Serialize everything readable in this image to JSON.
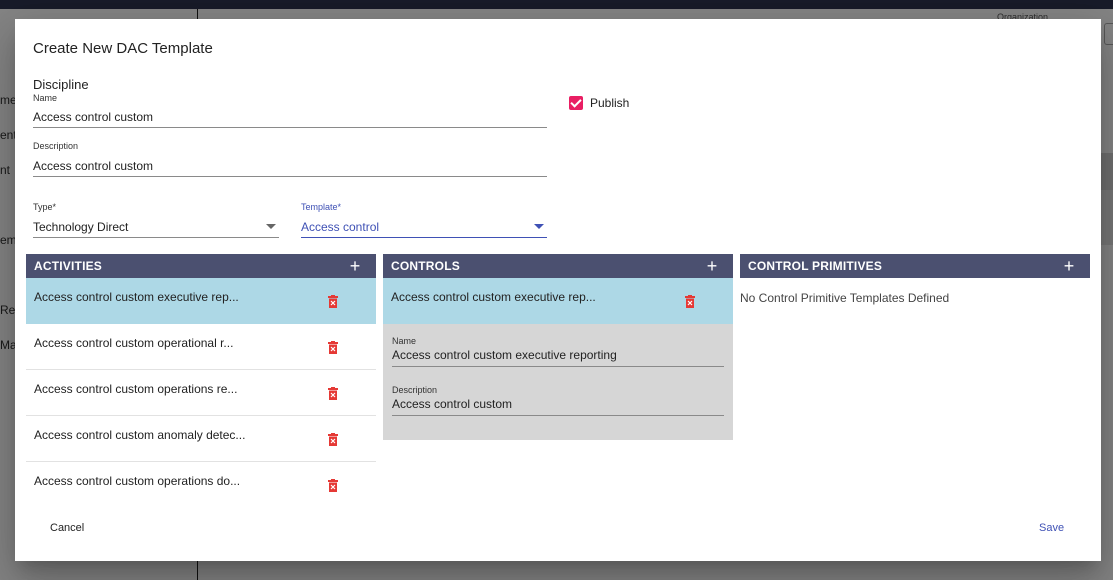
{
  "background": {
    "sidebar_fragments": [
      "me",
      "ent",
      "nt",
      "eme",
      "Re",
      "Ma"
    ],
    "org_label": "Organization"
  },
  "dialog": {
    "title": "Create New DAC Template",
    "section_label": "Discipline",
    "name": {
      "label": "Name",
      "value": "Access control custom"
    },
    "description": {
      "label": "Description",
      "value": "Access control custom"
    },
    "publish": {
      "label": "Publish",
      "checked": true,
      "color": "#e91e63"
    },
    "type": {
      "label": "Type*",
      "value": "Technology Direct"
    },
    "template": {
      "label": "Template*",
      "value": "Access control"
    },
    "accent_color": "#3f51b5",
    "header_color": "#4b5070",
    "selected_color": "#add8e6"
  },
  "activities": {
    "title": "ACTIVITIES",
    "add_icon": "+",
    "items": [
      "Access control custom executive rep...",
      "Access control custom operational r...",
      "Access control custom operations re...",
      "Access control custom anomaly detec...",
      "Access control custom operations do..."
    ]
  },
  "controls": {
    "title": "CONTROLS",
    "add_icon": "+",
    "items": [
      "Access control custom executive rep..."
    ],
    "detail": {
      "name_label": "Name",
      "name_value": "Access control custom executive reporting",
      "description_label": "Description",
      "description_value": "Access control custom"
    }
  },
  "primitives": {
    "title": "CONTROL PRIMITIVES",
    "add_icon": "+",
    "empty_message": "No Control Primitive Templates Defined"
  },
  "footer": {
    "cancel_label": "Cancel",
    "save_label": "Save"
  }
}
